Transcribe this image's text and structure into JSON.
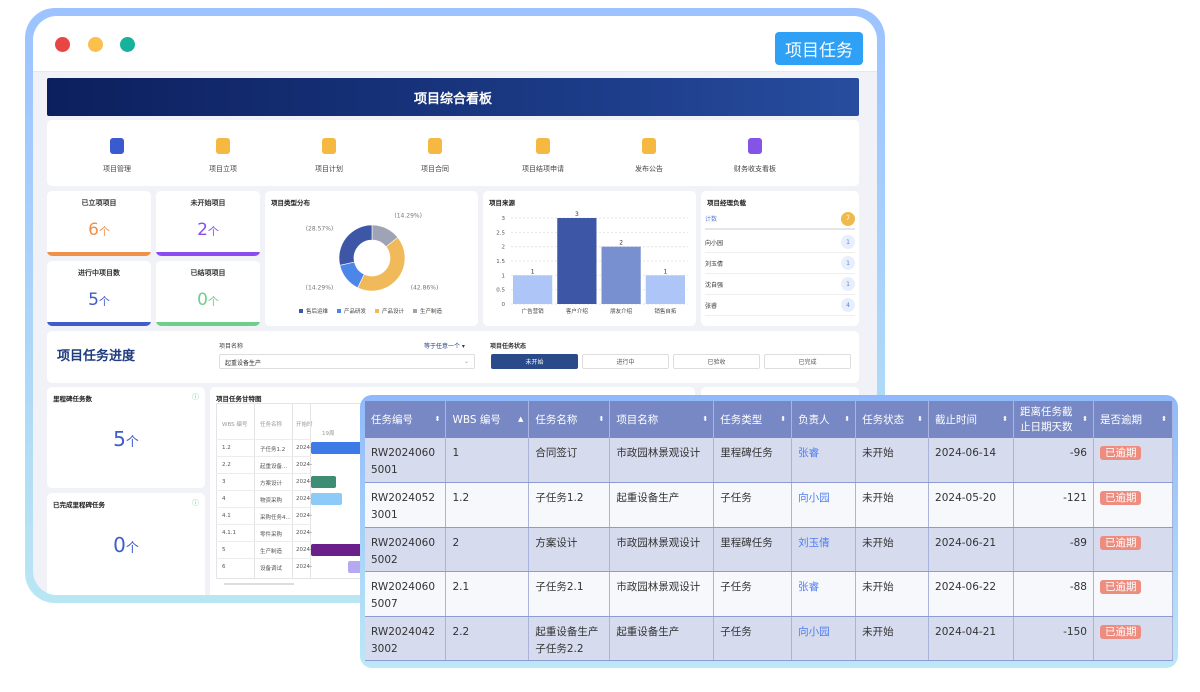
{
  "window": {
    "tab_button": "项目任务",
    "colors": {
      "close": "#e84545",
      "minimize": "#fbbf4d",
      "maximize": "#16b29c"
    }
  },
  "banner": {
    "title": "项目综合看板"
  },
  "nav": [
    {
      "label": "项目管理",
      "icon": "document-icon",
      "color": "#3a5bd0"
    },
    {
      "label": "项目立项",
      "icon": "coin-icon",
      "color": "#f5b941"
    },
    {
      "label": "项目计划",
      "icon": "coin-icon",
      "color": "#f5b941"
    },
    {
      "label": "项目合同",
      "icon": "contract-icon",
      "color": "#f5b941"
    },
    {
      "label": "项目结项申请",
      "icon": "check-doc-icon",
      "color": "#f5b941"
    },
    {
      "label": "发布公告",
      "icon": "bell-icon",
      "color": "#f5b941"
    },
    {
      "label": "财务收支看板",
      "icon": "chart-icon",
      "color": "#8354e6"
    }
  ],
  "stats": [
    {
      "label": "已立项项目",
      "value": "6",
      "unit": "个",
      "color": "#f0914a"
    },
    {
      "label": "未开始项目",
      "value": "2",
      "unit": "个",
      "color": "#8a4cf0"
    },
    {
      "label": "进行中项目数",
      "value": "5",
      "unit": "个",
      "color": "#3f5cc8"
    },
    {
      "label": "已结项项目",
      "value": "0",
      "unit": "个",
      "color": "#6fcf8a"
    }
  ],
  "chart_data": [
    {
      "type": "pie",
      "title": "项目类型分布",
      "donut": true,
      "slices": [
        {
          "name": "生产制造",
          "value": 14.29,
          "label": "(14.29%)",
          "color": "#9ea3b5"
        },
        {
          "name": "产品设计",
          "value": 42.86,
          "label": "(42.86%)",
          "color": "#f0b95a"
        },
        {
          "name": "产品研发",
          "value": 14.29,
          "label": "(14.29%)",
          "color": "#4b86e8"
        },
        {
          "name": "售后运维",
          "value": 28.57,
          "label": "(28.57%)",
          "color": "#3d56a6"
        }
      ],
      "legend": [
        "售后运维",
        "产品研发",
        "产品设计",
        "生产制造"
      ],
      "legend_placement": "bottom"
    },
    {
      "type": "bar",
      "title": "项目来源",
      "categories": [
        "广告营销",
        "客户介绍",
        "朋友介绍",
        "销售自拓"
      ],
      "values": [
        1,
        3,
        2,
        1
      ],
      "colors": [
        "#aec6f7",
        "#3d56a6",
        "#7890cf",
        "#aec6f7"
      ],
      "ylim": [
        0,
        3
      ],
      "yticks": [
        "0",
        "0.5",
        "1",
        "1.5",
        "2",
        "2.5",
        "3"
      ],
      "grid": true
    }
  ],
  "managers": {
    "title": "项目经理负载",
    "header": {
      "label": "计数",
      "value": "7"
    },
    "rows": [
      {
        "name": "向小园",
        "value": "1"
      },
      {
        "name": "刘玉倩",
        "value": "1"
      },
      {
        "name": "沈自强",
        "value": "1"
      },
      {
        "name": "张睿",
        "value": "4"
      }
    ]
  },
  "progress": {
    "title": "项目任务进度",
    "project_label": "项目名称",
    "match_label": "等于任意一个 ▾",
    "project_value": "起重设备生产",
    "status_label": "项目任务状态",
    "statuses": [
      "未开始",
      "进行中",
      "已验收",
      "已完成"
    ],
    "active": "未开始"
  },
  "milestone": {
    "label": "里程碑任务数",
    "value": "5",
    "unit": "个"
  },
  "done_milestone": {
    "label": "已完成里程碑任务",
    "value": "0",
    "unit": "个"
  },
  "gantt": {
    "title": "项目任务甘特图",
    "headers": [
      "WBS 编号",
      "任务名称",
      "开始时"
    ],
    "week": "19周",
    "rows": [
      {
        "wbs": "1.2",
        "name": "子任务1.2",
        "start": "2024-"
      },
      {
        "wbs": "2.2",
        "name": "起重设备...",
        "start": "2024-"
      },
      {
        "wbs": "3",
        "name": "方案设计",
        "start": "2024-"
      },
      {
        "wbs": "4",
        "name": "物资采购",
        "start": "2024-"
      },
      {
        "wbs": "4.1",
        "name": "采购任务4...",
        "start": "2024-"
      },
      {
        "wbs": "4.1.1",
        "name": "零件采购",
        "start": "2024-"
      },
      {
        "wbs": "5",
        "name": "生产制造",
        "start": "2024-"
      },
      {
        "wbs": "6",
        "name": "设备调试",
        "start": "2024-"
      }
    ]
  },
  "table": {
    "headers": [
      "任务编号",
      "WBS 编号",
      "任务名称",
      "项目名称",
      "任务类型",
      "负责人",
      "任务状态",
      "截止时间",
      "距离任务截止日期天数",
      "是否逾期"
    ],
    "rows": [
      [
        "RW20240605001",
        "1",
        "合同签订",
        "市政园林景观设计",
        "里程碑任务",
        "张睿",
        "未开始",
        "2024-06-14",
        "-96",
        "已逾期"
      ],
      [
        "RW20240523001",
        "1.2",
        "子任务1.2",
        "起重设备生产",
        "子任务",
        "向小园",
        "未开始",
        "2024-05-20",
        "-121",
        "已逾期"
      ],
      [
        "RW20240605002",
        "2",
        "方案设计",
        "市政园林景观设计",
        "里程碑任务",
        "刘玉倩",
        "未开始",
        "2024-06-21",
        "-89",
        "已逾期"
      ],
      [
        "RW20240605007",
        "2.1",
        "子任务2.1",
        "市政园林景观设计",
        "子任务",
        "张睿",
        "未开始",
        "2024-06-22",
        "-88",
        "已逾期"
      ],
      [
        "RW20240423002",
        "2.2",
        "起重设备生产子任务2.2",
        "起重设备生产",
        "子任务",
        "向小园",
        "未开始",
        "2024-04-21",
        "-150",
        "已逾期"
      ]
    ]
  }
}
